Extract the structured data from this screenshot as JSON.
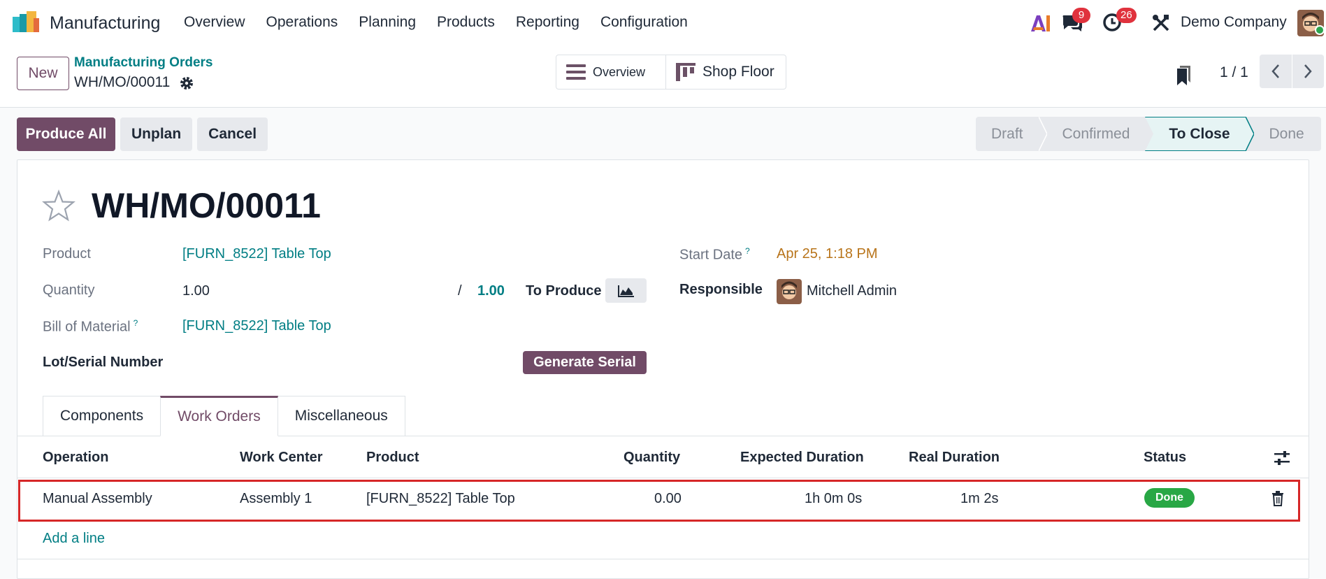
{
  "app": {
    "name": "Manufacturing",
    "menu": [
      "Overview",
      "Operations",
      "Planning",
      "Products",
      "Reporting",
      "Configuration"
    ],
    "chat_badge": "9",
    "activity_badge": "26",
    "company": "Demo Company",
    "colors": {
      "brand": "#714b67",
      "link": "#017e84",
      "danger": "#e0323d",
      "success": "#28a745"
    }
  },
  "control": {
    "new_label": "New",
    "breadcrumb_parent": "Manufacturing Orders",
    "breadcrumb_current": "WH/MO/00011",
    "switch_overview": "Overview",
    "switch_shopfloor": "Shop Floor",
    "pager": "1 / 1"
  },
  "actions": {
    "produce_all": "Produce All",
    "unplan": "Unplan",
    "cancel": "Cancel"
  },
  "statusbar": {
    "stages": [
      "Draft",
      "Confirmed",
      "To Close",
      "Done"
    ],
    "active": "To Close"
  },
  "record": {
    "title": "WH/MO/00011",
    "product_label": "Product",
    "product_value": "[FURN_8522] Table Top",
    "quantity_label": "Quantity",
    "quantity_value": "1.00",
    "quantity_sep": "/",
    "quantity_total": "1.00",
    "to_produce": "To Produce",
    "bom_label": "Bill of Material",
    "bom_value": "[FURN_8522] Table Top",
    "lot_label": "Lot/Serial Number",
    "generate_serial": "Generate Serial",
    "start_date_label": "Start Date",
    "start_date_value": "Apr 25, 1:18 PM",
    "responsible_label": "Responsible",
    "responsible_value": "Mitchell Admin",
    "help_mark": "?"
  },
  "tabs": [
    "Components",
    "Work Orders",
    "Miscellaneous"
  ],
  "active_tab": "Work Orders",
  "table": {
    "headers": [
      "Operation",
      "Work Center",
      "Product",
      "Quantity",
      "Expected Duration",
      "Real Duration",
      "Status"
    ],
    "rows": [
      {
        "operation": "Manual Assembly",
        "work_center": "Assembly 1",
        "product": "[FURN_8522] Table Top",
        "quantity": "0.00",
        "expected_duration": "1h 0m 0s",
        "real_duration": "1m 2s",
        "status": "Done"
      }
    ],
    "add_line": "Add a line"
  }
}
